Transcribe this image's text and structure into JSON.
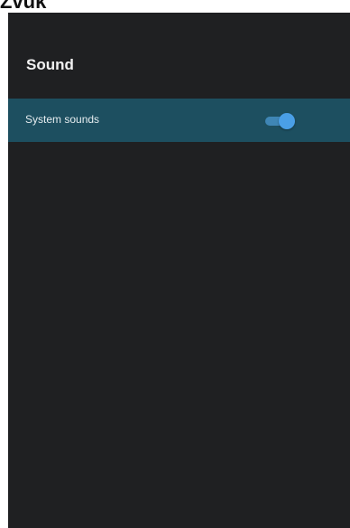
{
  "top_caption": "Zvuk",
  "panel": {
    "title": "Sound",
    "settings": [
      {
        "label": "System sounds",
        "toggle_on": true
      }
    ]
  },
  "colors": {
    "panel_background": "#1f2022",
    "selected_row": "#1d4f60",
    "toggle_accent": "#4a9fe6"
  }
}
